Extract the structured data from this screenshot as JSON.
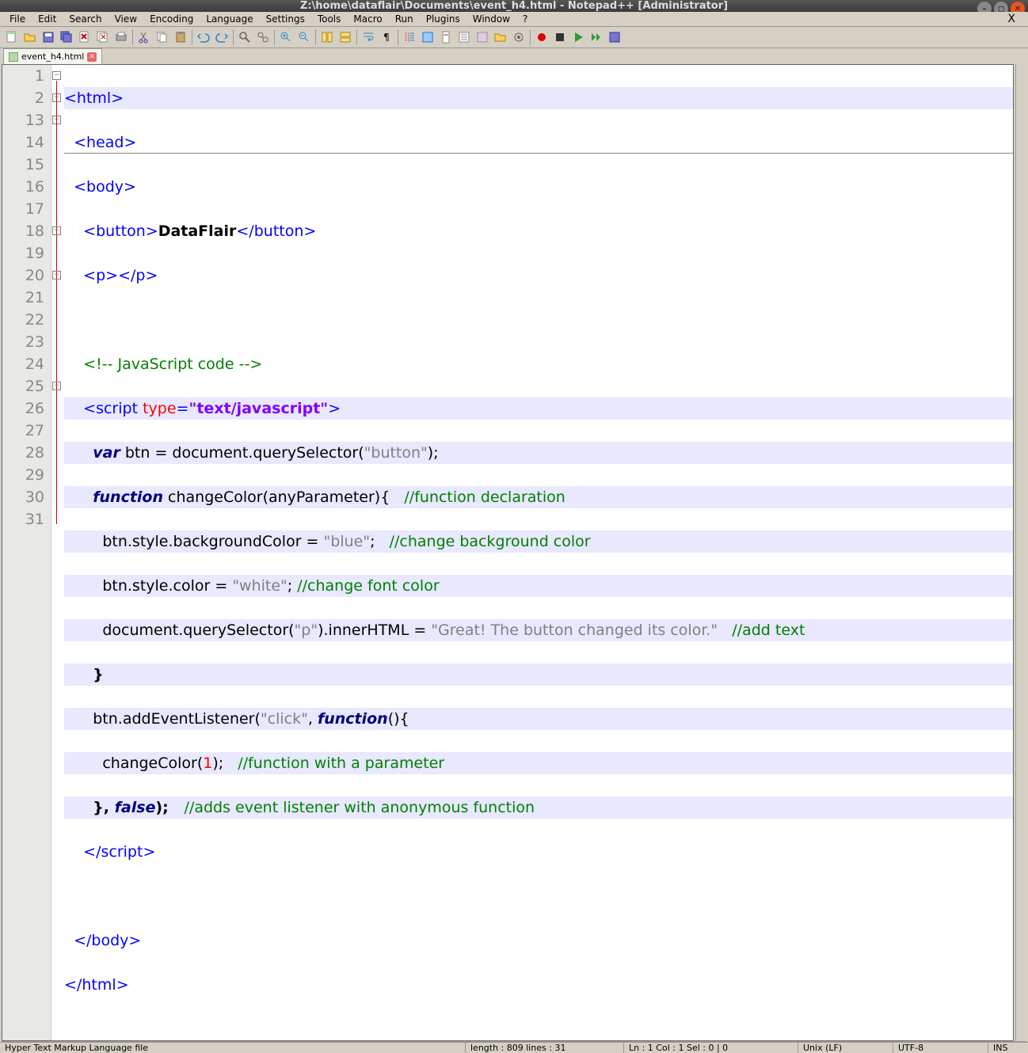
{
  "title": "Z:\\home\\dataflair\\Documents\\event_h4.html - Notepad++ [Administrator]",
  "menu": [
    "File",
    "Edit",
    "Search",
    "View",
    "Encoding",
    "Language",
    "Settings",
    "Tools",
    "Macro",
    "Run",
    "Plugins",
    "Window",
    "?"
  ],
  "tab": {
    "name": "event_h4.html"
  },
  "lines": [
    "1",
    "2",
    "13",
    "14",
    "15",
    "16",
    "17",
    "18",
    "19",
    "20",
    "21",
    "22",
    "23",
    "24",
    "25",
    "26",
    "27",
    "28",
    "29",
    "30",
    "31"
  ],
  "status": {
    "lang": "Hyper Text Markup Language file",
    "len": "length : 809   lines : 31",
    "pos": "Ln : 1   Col : 1   Sel : 0 | 0",
    "eol": "Unix (LF)",
    "enc": "UTF-8",
    "ins": "INS"
  },
  "code": {
    "l1_tag": "<html>",
    "l2_tag": "<head>",
    "l3_tag": "<body>",
    "l4_a": "<button>",
    "l4_b": "DataFlair",
    "l4_c": "</button>",
    "l5_a": "<p></p>",
    "l7_cmt": "<!-- JavaScript code -->",
    "l8_a": "<script ",
    "l8_b": "type",
    "l8_c": "=",
    "l8_d": "\"text/javascript\"",
    "l8_e": ">",
    "l9_a": "var",
    "l9_b": " btn = document.querySelector(",
    "l9_c": "\"button\"",
    "l9_d": ");",
    "l10_a": "function",
    "l10_b": " changeColor(anyParameter){   ",
    "l10_c": "//function declaration",
    "l11_a": "btn.style.backgroundColor = ",
    "l11_b": "\"blue\"",
    "l11_c": ";   ",
    "l11_d": "//change background color",
    "l12_a": "btn.style.color = ",
    "l12_b": "\"white\"",
    "l12_c": "; ",
    "l12_d": "//change font color",
    "l13_a": "document.querySelector(",
    "l13_b": "\"p\"",
    "l13_c": ").innerHTML = ",
    "l13_d": "\"Great! The button changed its color.\"",
    "l13_e": "   ",
    "l13_f": "//add text",
    "l14_a": "}",
    "l15_a": "btn.addEventListener(",
    "l15_b": "\"click\"",
    "l15_c": ", ",
    "l15_d": "function",
    "l15_e": "(){",
    "l16_a": "changeColor(",
    "l16_b": "1",
    "l16_c": ");   ",
    "l16_d": "//function with a parameter",
    "l17_a": "}, ",
    "l17_b": "false",
    "l17_c": ");   ",
    "l17_d": "//adds event listener with anonymous function",
    "l18_a": "</script>",
    "l20_a": "</body>",
    "l21_a": "</html>"
  }
}
